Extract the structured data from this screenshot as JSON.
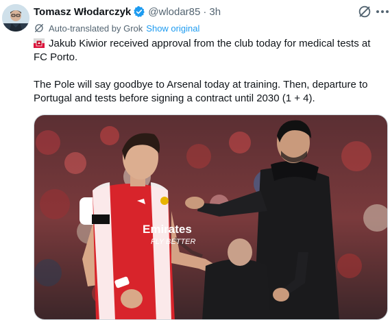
{
  "post": {
    "author_name": "Tomasz Włodarczyk",
    "handle": "@wlodar85",
    "separator": "·",
    "time": "3h",
    "translation_note": "Auto-translated by Grok",
    "show_original_label": "Show original",
    "paragraph_1": "Jakub Kiwior received approval from the club today for medical tests at FC Porto.",
    "paragraph_2": "The Pole will say goodbye to Arsenal today at training. Then, departure to Portugal and tests before signing a contract until 2030 (1 + 4).",
    "flag_icon": "poland-flag-icon",
    "verified_color": "#1d9bf0"
  },
  "media": {
    "shirt_sponsor_line1": "Emirates",
    "shirt_sponsor_line2": "FLY BETTER"
  }
}
